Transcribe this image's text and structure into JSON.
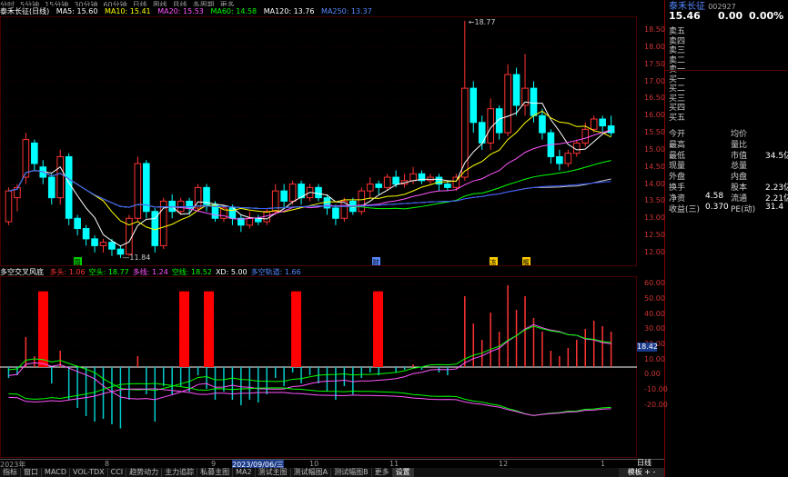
{
  "topbar": {
    "items": [
      "分时",
      "5分钟",
      "15分钟",
      "30分钟",
      "60分钟",
      "日线",
      "周线",
      "月线",
      "多周期",
      "更多"
    ]
  },
  "infobar": {
    "title": "泰禾长征(日线)",
    "ma5": "MA5: 15.60",
    "ma10": "MA10: 15.41",
    "ma20": "MA20: 15.53",
    "ma60": "MA60: 14.58",
    "ma120": "MA120: 13.76",
    "ma250": "MA250: 13.37"
  },
  "main_chart": {
    "price_ticks": [
      "18.50",
      "18.00",
      "17.50",
      "17.00",
      "16.50",
      "16.00",
      "15.50",
      "15.00",
      "14.50",
      "14.00",
      "13.50",
      "13.00",
      "12.50",
      "12.00"
    ],
    "high_label": "18.77",
    "low_label": "11.84",
    "markers": [
      {
        "label": "国",
        "color": "#00cc00"
      },
      {
        "label": "财",
        "color": "#5588ff"
      },
      {
        "label": "冻",
        "color": "#ffcc00"
      },
      {
        "label": "榴",
        "color": "#ffcc00"
      }
    ],
    "candles": [
      [
        12.9,
        13.8,
        12.8,
        13.9,
        "up"
      ],
      [
        13.6,
        13.9,
        13.2,
        14.0,
        "up"
      ],
      [
        14.2,
        15.3,
        14.0,
        15.5,
        "up"
      ],
      [
        15.2,
        14.6,
        14.4,
        15.3,
        "down"
      ],
      [
        14.5,
        14.2,
        14.0,
        14.7,
        "down"
      ],
      [
        14.2,
        13.6,
        13.4,
        14.3,
        "down"
      ],
      [
        13.6,
        14.8,
        13.4,
        15.0,
        "up"
      ],
      [
        14.8,
        13.0,
        12.8,
        14.9,
        "down"
      ],
      [
        13.0,
        12.7,
        12.5,
        13.1,
        "down"
      ],
      [
        12.7,
        12.4,
        12.2,
        12.8,
        "down"
      ],
      [
        12.4,
        12.2,
        12.0,
        12.5,
        "down"
      ],
      [
        12.2,
        12.3,
        12.0,
        12.4,
        "up"
      ],
      [
        12.3,
        12.1,
        11.9,
        12.4,
        "down"
      ],
      [
        12.1,
        11.95,
        11.84,
        12.2,
        "down"
      ],
      [
        11.95,
        13.0,
        11.9,
        13.1,
        "up"
      ],
      [
        13.0,
        14.6,
        12.9,
        14.8,
        "up"
      ],
      [
        14.6,
        13.2,
        13.0,
        14.7,
        "down"
      ],
      [
        13.2,
        12.2,
        12.0,
        13.3,
        "down"
      ],
      [
        12.2,
        13.5,
        12.1,
        13.6,
        "up"
      ],
      [
        13.5,
        13.2,
        13.0,
        13.7,
        "down"
      ],
      [
        13.2,
        13.5,
        13.1,
        13.6,
        "up"
      ],
      [
        13.5,
        13.3,
        13.1,
        13.6,
        "down"
      ],
      [
        13.3,
        13.9,
        13.2,
        14.0,
        "up"
      ],
      [
        13.9,
        13.4,
        13.2,
        14.0,
        "down"
      ],
      [
        13.4,
        13.0,
        12.9,
        13.5,
        "down"
      ],
      [
        13.0,
        13.3,
        12.9,
        13.4,
        "up"
      ],
      [
        13.3,
        13.0,
        12.8,
        13.4,
        "down"
      ],
      [
        13.0,
        12.8,
        12.6,
        13.1,
        "down"
      ],
      [
        12.8,
        13.0,
        12.7,
        13.2,
        "up"
      ],
      [
        13.0,
        12.9,
        12.8,
        13.1,
        "down"
      ],
      [
        12.9,
        13.2,
        12.8,
        13.3,
        "up"
      ],
      [
        13.2,
        13.8,
        13.1,
        14.0,
        "up"
      ],
      [
        13.8,
        13.5,
        13.3,
        14.0,
        "down"
      ],
      [
        13.5,
        14.0,
        13.4,
        14.1,
        "up"
      ],
      [
        14.0,
        13.6,
        13.4,
        14.1,
        "down"
      ],
      [
        13.6,
        13.9,
        13.5,
        14.0,
        "up"
      ],
      [
        13.9,
        13.6,
        13.5,
        14.0,
        "down"
      ],
      [
        13.6,
        13.3,
        13.1,
        13.7,
        "down"
      ],
      [
        13.3,
        13.0,
        12.8,
        13.4,
        "down"
      ],
      [
        13.0,
        13.5,
        12.9,
        13.6,
        "up"
      ],
      [
        13.5,
        13.2,
        13.1,
        13.6,
        "down"
      ],
      [
        13.2,
        13.8,
        13.1,
        13.9,
        "up"
      ],
      [
        13.8,
        14.0,
        13.6,
        14.2,
        "up"
      ],
      [
        14.0,
        13.9,
        13.7,
        14.1,
        "down"
      ],
      [
        13.9,
        14.2,
        13.8,
        14.3,
        "up"
      ],
      [
        14.2,
        14.0,
        13.9,
        14.4,
        "down"
      ],
      [
        14.0,
        14.1,
        13.9,
        14.3,
        "up"
      ],
      [
        14.1,
        14.3,
        14.0,
        14.5,
        "up"
      ],
      [
        14.3,
        14.1,
        14.0,
        14.4,
        "down"
      ],
      [
        14.1,
        14.2,
        14.0,
        14.3,
        "up"
      ],
      [
        14.2,
        14.0,
        13.8,
        14.3,
        "down"
      ],
      [
        14.0,
        13.9,
        13.8,
        14.1,
        "down"
      ],
      [
        13.9,
        14.2,
        13.8,
        14.3,
        "up"
      ],
      [
        14.2,
        16.8,
        14.1,
        18.77,
        "up"
      ],
      [
        16.8,
        15.8,
        15.5,
        17.0,
        "down"
      ],
      [
        15.8,
        15.2,
        15.0,
        16.0,
        "down"
      ],
      [
        15.2,
        16.2,
        15.0,
        16.5,
        "up"
      ],
      [
        16.2,
        15.5,
        15.3,
        16.3,
        "down"
      ],
      [
        15.5,
        17.2,
        15.4,
        17.5,
        "up"
      ],
      [
        17.2,
        16.3,
        16.0,
        17.4,
        "down"
      ],
      [
        16.3,
        16.8,
        16.0,
        17.8,
        "up"
      ],
      [
        16.8,
        16.0,
        15.8,
        17.0,
        "down"
      ],
      [
        16.0,
        15.5,
        15.3,
        16.2,
        "down"
      ],
      [
        15.5,
        14.8,
        14.6,
        15.6,
        "down"
      ],
      [
        14.8,
        14.6,
        14.4,
        15.0,
        "down"
      ],
      [
        14.6,
        14.9,
        14.5,
        15.0,
        "up"
      ],
      [
        14.9,
        15.2,
        14.8,
        15.3,
        "up"
      ],
      [
        15.2,
        15.6,
        15.1,
        15.8,
        "up"
      ],
      [
        15.6,
        15.9,
        15.5,
        16.0,
        "up"
      ],
      [
        15.9,
        15.7,
        15.5,
        16.0,
        "down"
      ],
      [
        15.7,
        15.5,
        15.4,
        16.0,
        "down"
      ]
    ]
  },
  "indicator": {
    "name": "多空交叉风底",
    "items": [
      {
        "text": "多头: 1.06",
        "color": "#ff3333"
      },
      {
        "text": "空头: 18.77",
        "color": "#00ff00"
      },
      {
        "text": "多线: 1.24",
        "color": "#ff55ff"
      },
      {
        "text": "空线: 18.52",
        "color": "#00ff00"
      },
      {
        "text": "XD: 5.00",
        "color": "#ffffff"
      },
      {
        "text": "多空轨道: 1.66",
        "color": "#5588ff"
      }
    ],
    "ticks": [
      "60.00",
      "50.00",
      "40.00",
      "30.00",
      "20.00",
      "10.00",
      "0.00",
      "-10.00",
      "-20.00"
    ],
    "current_value": "18.42"
  },
  "datebar": {
    "labels": [
      "2023年",
      "8",
      "9",
      "2023/09/06/三",
      "10",
      "11",
      "12",
      "1"
    ],
    "day_button": "日线"
  },
  "tabs": {
    "items": [
      "指标",
      "窗口",
      "MACD",
      "VOL-TDX",
      "CCI",
      "趋势动力",
      "主力追踪",
      "私募主图",
      "MA2",
      "测试主图",
      "测试幅图A",
      "测试幅图B",
      "更多",
      "设置"
    ],
    "active_index": 13,
    "right_button": "模板 + -"
  },
  "right_panel": {
    "title": "泰禾长征",
    "code": "002927",
    "price": "15.46",
    "change": "0.00",
    "pct": "0.00%",
    "order_book": [
      "卖五",
      "卖四",
      "卖三",
      "卖二",
      "卖一",
      "买一",
      "买二",
      "买三",
      "买四",
      "买五"
    ],
    "stats": [
      {
        "l1": "今开",
        "v1": "",
        "l2": "均价",
        "v2": ""
      },
      {
        "l1": "最高",
        "v1": "",
        "l2": "量比",
        "v2": ""
      },
      {
        "l1": "最低",
        "v1": "",
        "l2": "市值",
        "v2": "34.5亿"
      },
      {
        "l1": "现量",
        "v1": "",
        "l2": "总量",
        "v2": ""
      },
      {
        "l1": "外盘",
        "v1": "",
        "l2": "内盘",
        "v2": ""
      },
      {
        "l1": "换手",
        "v1": "",
        "l2": "股本",
        "v2": "2.23亿"
      },
      {
        "l1": "净资",
        "v1": "4.58",
        "l2": "流通",
        "v2": "2.21亿"
      },
      {
        "l1": "收益(三)",
        "v1": "0.370",
        "l2": "PE(动)",
        "v2": "31.4"
      }
    ]
  }
}
